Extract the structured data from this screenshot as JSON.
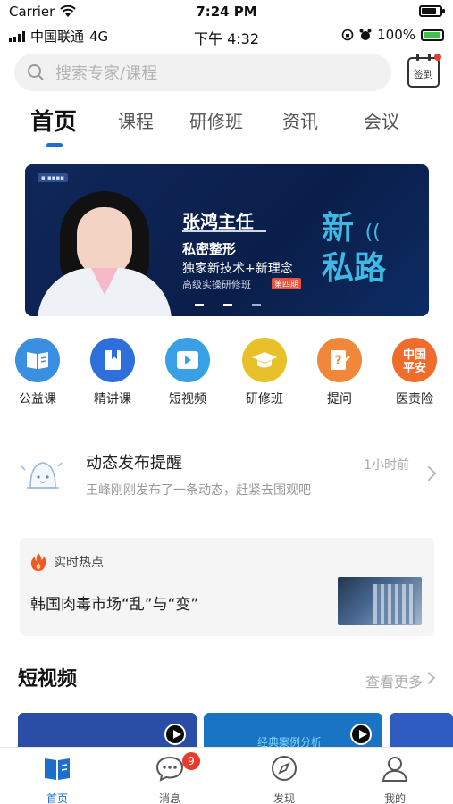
{
  "sim_status": {
    "carrier": "Carrier",
    "time": "7:24 PM"
  },
  "os_status": {
    "carrier": "中国联通",
    "network": "4G",
    "time": "下午 4:32",
    "battery": "100%"
  },
  "search": {
    "placeholder": "搜索专家/课程"
  },
  "checkin": {
    "label": "签到"
  },
  "tabs": [
    {
      "label": "首页",
      "active": true
    },
    {
      "label": "课程"
    },
    {
      "label": "研修班"
    },
    {
      "label": "资讯"
    },
    {
      "label": "会议"
    }
  ],
  "banner": {
    "line1": "张鸿主任",
    "line2": "私密整形",
    "line3": "独家新技术+新理念",
    "line4": "高级实操研修班",
    "badge": "第四期",
    "big_line1": "新",
    "big_line2": "私路"
  },
  "quick_icons": [
    {
      "label": "公益课",
      "icon": "book-icon",
      "color": "#3b8fe0"
    },
    {
      "label": "精讲课",
      "icon": "bookmark-book-icon",
      "color": "#2f6fdc"
    },
    {
      "label": "短视频",
      "icon": "play-icon",
      "color": "#3aa0e6"
    },
    {
      "label": "研修班",
      "icon": "graduation-cap-icon",
      "color": "#e8c12a"
    },
    {
      "label": "提问",
      "icon": "question-doc-icon",
      "color": "#f0873a"
    },
    {
      "label": "医责险",
      "icon": "ping-an-logo-icon",
      "color": "#ef6c2c",
      "logo_text": "中国平安"
    }
  ],
  "notice": {
    "title": "动态发布提醒",
    "time": "1小时前",
    "desc": "王峰刚刚发布了一条动态，赶紧去围观吧"
  },
  "hot": {
    "label": "实时热点",
    "title": "韩国肉毒市场“乱”与“变”"
  },
  "short_video": {
    "title": "短视频",
    "more": "查看更多",
    "thumb2_text": "经典案例分析"
  },
  "bottom_nav": [
    {
      "label": "首页",
      "icon": "book-icon",
      "active": true
    },
    {
      "label": "消息",
      "icon": "chat-bubble-icon",
      "badge": "9"
    },
    {
      "label": "发现",
      "icon": "compass-icon"
    },
    {
      "label": "我的",
      "icon": "user-icon"
    }
  ],
  "colors": {
    "accent": "#1d6ecf",
    "badge": "#e83a2e"
  }
}
